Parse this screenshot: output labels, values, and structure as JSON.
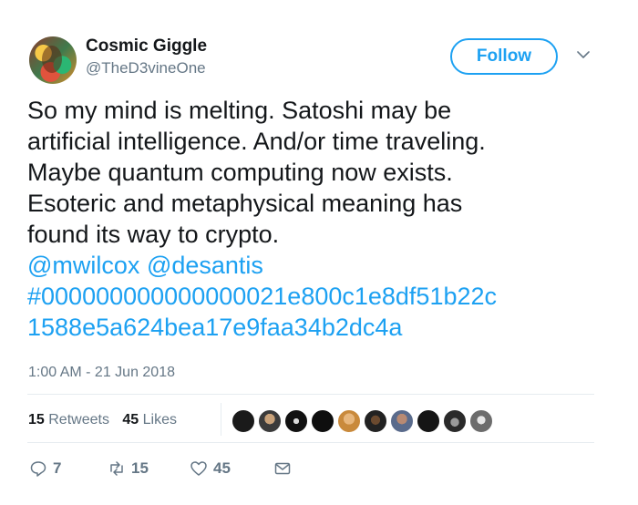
{
  "author": {
    "name": "Cosmic Giggle",
    "handle": "@TheD3vineOne"
  },
  "follow_label": "Follow",
  "tweet": {
    "lines": [
      "So my mind is melting. Satoshi may be",
      "artificial intelligence. And/or time traveling.",
      "Maybe quantum computing now exists.",
      "Esoteric and metaphysical meaning has",
      "found its way to crypto."
    ],
    "mention1": "@mwilcox",
    "mention2": "@desantis",
    "hashtag_line1": "#000000000000000021e800c1e8df51b22c",
    "hashtag_line2": "1588e5a624bea17e9faa34b2dc4a"
  },
  "timestamp": "1:00 AM - 21 Jun 2018",
  "stats": {
    "retweets_count": "15",
    "retweets_label": "Retweets",
    "likes_count": "45",
    "likes_label": "Likes"
  },
  "actions": {
    "replies": "7",
    "retweets": "15",
    "likes": "45"
  },
  "icons": [
    "chevron-down-icon",
    "reply-icon",
    "retweet-icon",
    "heart-icon",
    "message-icon"
  ],
  "colors": {
    "accent": "#1da1f2",
    "secondary_text": "#657786",
    "primary_text": "#14171a",
    "divider": "#e6ecf0"
  }
}
